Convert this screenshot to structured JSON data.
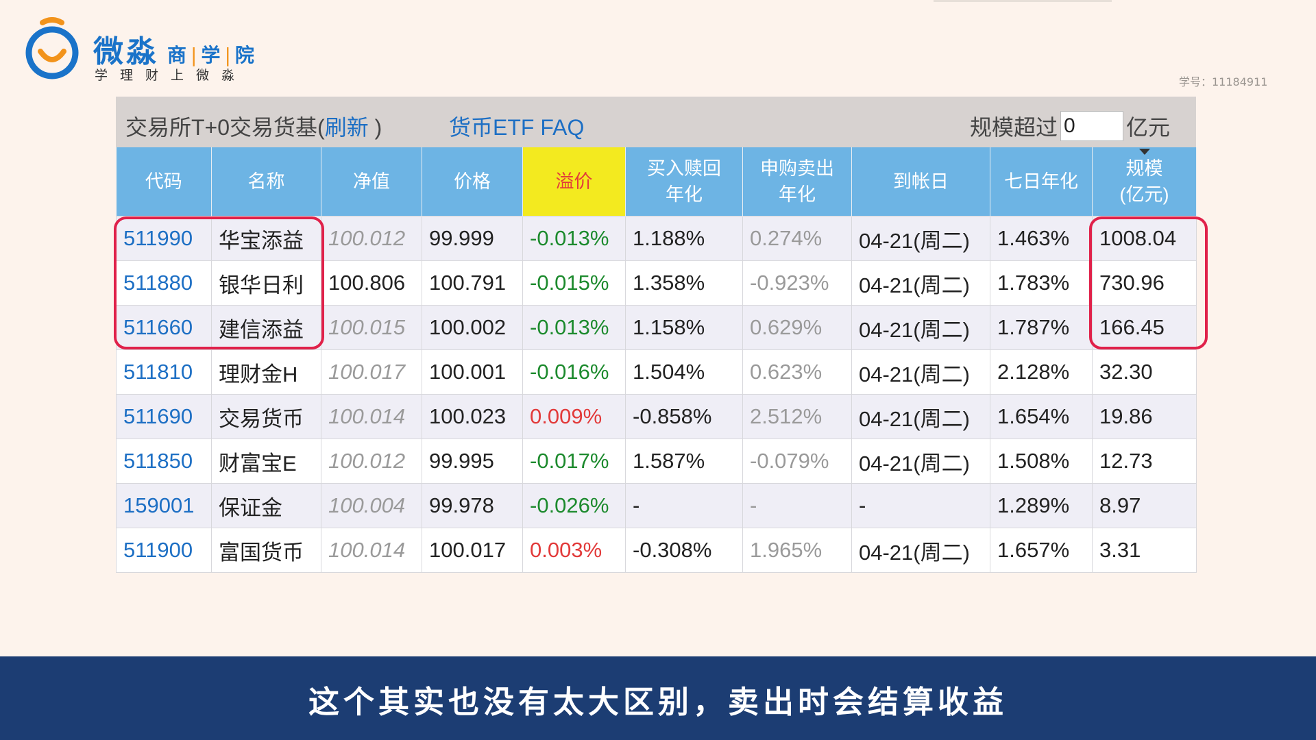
{
  "brand": {
    "main": "微淼",
    "sub": [
      "商",
      "学",
      "院"
    ],
    "slogan": "学理财上微淼"
  },
  "student_id": "学号：11184911",
  "panel": {
    "title_prefix": "交易所T+0交易货基(",
    "refresh_link": "刷新",
    "title_suffix": " )",
    "faq_link": "货币ETF FAQ",
    "scale_label": "规模超过",
    "scale_value": "0",
    "scale_unit": "亿元"
  },
  "table": {
    "headers": {
      "code": "代码",
      "name": "名称",
      "nav": "净值",
      "price": "价格",
      "premium": "溢价",
      "buy_redeem_line1": "买入赎回",
      "buy_redeem_line2": "年化",
      "sub_sell_line1": "申购卖出",
      "sub_sell_line2": "年化",
      "arrival": "到帐日",
      "seven_day": "七日年化",
      "scale_line1": "规模",
      "scale_line2": "(亿元)"
    },
    "rows": [
      {
        "code": "511990",
        "name": "华宝添益",
        "nav": "100.012",
        "price": "99.999",
        "premium": "-0.013%",
        "premium_dir": "neg",
        "buy": "1.188%",
        "sub": "0.274%",
        "arrival": "04-21(周二)",
        "seven": "1.463%",
        "scale": "1008.04"
      },
      {
        "code": "511880",
        "name": "银华日利",
        "nav": "100.806",
        "price": "100.791",
        "premium": "-0.015%",
        "premium_dir": "neg",
        "buy": "1.358%",
        "sub": "-0.923%",
        "arrival": "04-21(周二)",
        "seven": "1.783%",
        "scale": "730.96"
      },
      {
        "code": "511660",
        "name": "建信添益",
        "nav": "100.015",
        "price": "100.002",
        "premium": "-0.013%",
        "premium_dir": "neg",
        "buy": "1.158%",
        "sub": "0.629%",
        "arrival": "04-21(周二)",
        "seven": "1.787%",
        "scale": "166.45"
      },
      {
        "code": "511810",
        "name": "理财金H",
        "nav": "100.017",
        "price": "100.001",
        "premium": "-0.016%",
        "premium_dir": "neg",
        "buy": "1.504%",
        "sub": "0.623%",
        "arrival": "04-21(周二)",
        "seven": "2.128%",
        "scale": "32.30"
      },
      {
        "code": "511690",
        "name": "交易货币",
        "nav": "100.014",
        "price": "100.023",
        "premium": "0.009%",
        "premium_dir": "pos",
        "buy": "-0.858%",
        "sub": "2.512%",
        "arrival": "04-21(周二)",
        "seven": "1.654%",
        "scale": "19.86"
      },
      {
        "code": "511850",
        "name": "财富宝E",
        "nav": "100.012",
        "price": "99.995",
        "premium": "-0.017%",
        "premium_dir": "neg",
        "buy": "1.587%",
        "sub": "-0.079%",
        "arrival": "04-21(周二)",
        "seven": "1.508%",
        "scale": "12.73"
      },
      {
        "code": "159001",
        "name": "保证金",
        "nav": "100.004",
        "price": "99.978",
        "premium": "-0.026%",
        "premium_dir": "neg",
        "buy": "-",
        "sub": "-",
        "arrival": "-",
        "seven": "1.289%",
        "scale": "8.97"
      },
      {
        "code": "511900",
        "name": "富国货币",
        "nav": "100.014",
        "price": "100.017",
        "premium": "0.003%",
        "premium_dir": "pos",
        "buy": "-0.308%",
        "sub": "1.965%",
        "arrival": "04-21(周二)",
        "seven": "1.657%",
        "scale": "3.31"
      }
    ]
  },
  "subtitle": "这个其实也没有太大区别，卖出时会结算收益",
  "colors": {
    "brand_blue": "#1a73c9",
    "brand_orange": "#f2931b",
    "header_blue": "#6db4e4",
    "premium_yellow": "#f3ea1f",
    "negative_green": "#1c8a2d",
    "positive_red": "#e23a3a",
    "highlight_red": "#e0214a",
    "subtitle_bar": "#1c3d73"
  },
  "icons": {
    "logo": "weimiao-logo-icon",
    "sort": "sort-desc-indicator"
  }
}
